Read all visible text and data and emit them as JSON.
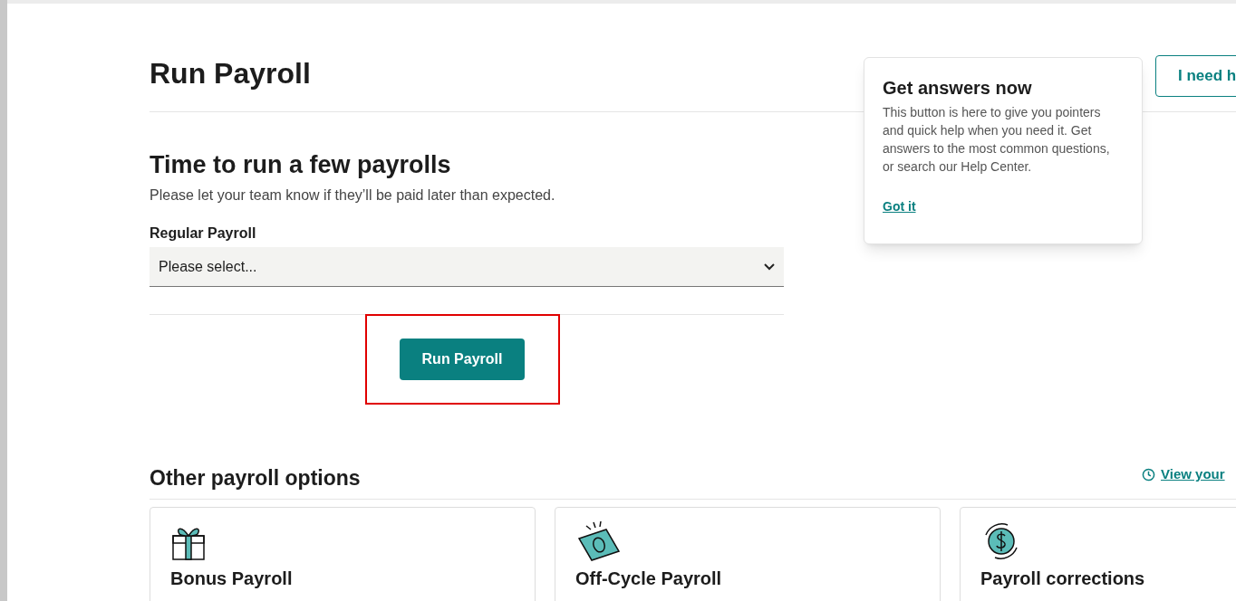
{
  "page_title": "Run Payroll",
  "help_button": {
    "label": "I need h"
  },
  "tooltip": {
    "title": "Get answers now",
    "body": "This button is here to give you pointers and quick help when you need it. Get answers to the most common questions, or search our Help Center.",
    "link": "Got it"
  },
  "section": {
    "title": "Time to run a few payrolls",
    "subtitle": "Please let your team know if they’ll be paid later than expected."
  },
  "select": {
    "label": "Regular Payroll",
    "value": "Please select..."
  },
  "run_button": {
    "label": "Run Payroll",
    "highlighted": true
  },
  "other": {
    "title": "Other payroll options",
    "link": "View your"
  },
  "cards": [
    {
      "kind": "gift",
      "title": "Bonus Payroll"
    },
    {
      "kind": "bill",
      "title": "Off-Cycle Payroll"
    },
    {
      "kind": "dollar",
      "title": "Payroll corrections"
    }
  ]
}
